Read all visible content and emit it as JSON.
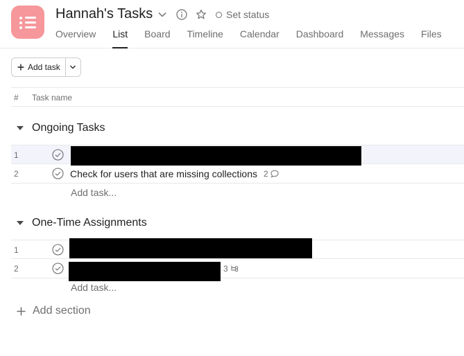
{
  "project": {
    "title": "Hannah's Tasks",
    "icon": "list-icon",
    "color": "#f6979b",
    "set_status_label": "Set status"
  },
  "tabs": [
    {
      "label": "Overview",
      "active": false
    },
    {
      "label": "List",
      "active": true
    },
    {
      "label": "Board",
      "active": false
    },
    {
      "label": "Timeline",
      "active": false
    },
    {
      "label": "Calendar",
      "active": false
    },
    {
      "label": "Dashboard",
      "active": false
    },
    {
      "label": "Messages",
      "active": false
    },
    {
      "label": "Files",
      "active": false
    }
  ],
  "toolbar": {
    "add_task_label": "Add task"
  },
  "columns": {
    "number": "#",
    "task_name": "Task name"
  },
  "sections": [
    {
      "title": "Ongoing Tasks",
      "tasks": [
        {
          "num": "1",
          "name": "",
          "redacted": true,
          "highlighted": true
        },
        {
          "num": "2",
          "name": "Check for users that are missing collections",
          "redacted": false,
          "comments": "2"
        }
      ],
      "add_task_placeholder": "Add task..."
    },
    {
      "title": "One-Time Assignments",
      "tasks": [
        {
          "num": "1",
          "name": "",
          "redacted": true
        },
        {
          "num": "2",
          "name": "",
          "redacted": true,
          "subtasks": "3"
        }
      ],
      "add_task_placeholder": "Add task..."
    }
  ],
  "add_section_label": "Add section"
}
